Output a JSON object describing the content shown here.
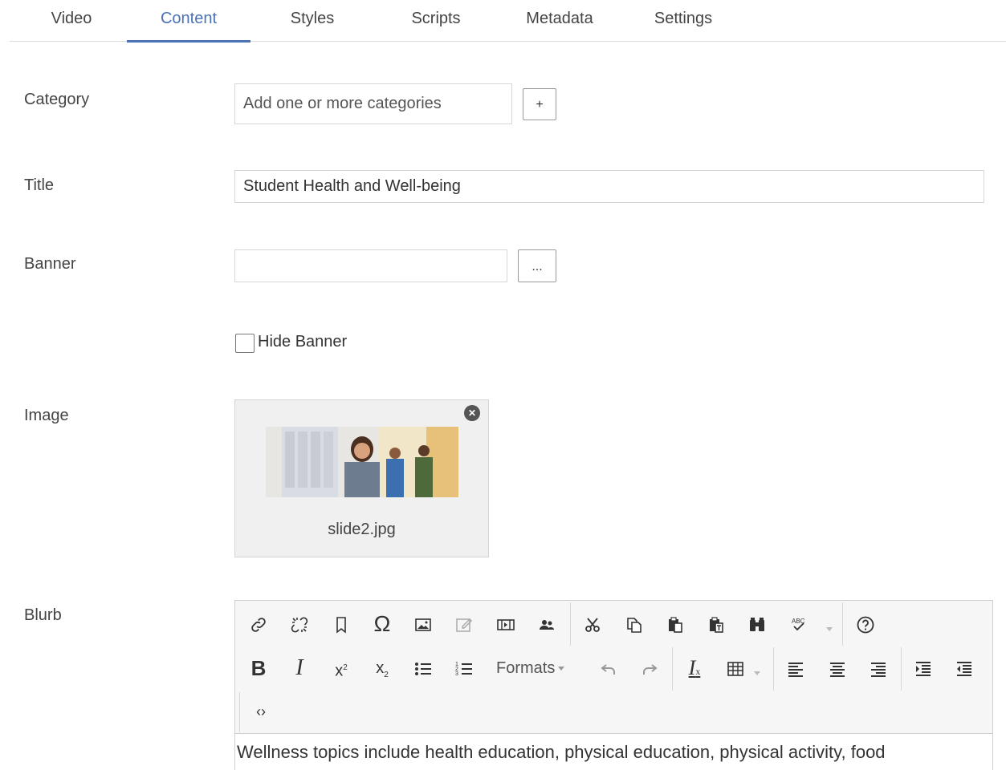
{
  "tabs": [
    {
      "label": "Video"
    },
    {
      "label": "Content",
      "active": true
    },
    {
      "label": "Styles"
    },
    {
      "label": "Scripts"
    },
    {
      "label": "Metadata"
    },
    {
      "label": "Settings"
    }
  ],
  "category": {
    "label": "Category",
    "placeholder": "Add one or more categories",
    "add_button": "+"
  },
  "title_field": {
    "label": "Title",
    "value": "Student Health and Well-being"
  },
  "banner": {
    "label": "Banner",
    "value": "",
    "browse_button": "...",
    "hide_label": "Hide Banner",
    "hide_checked": false
  },
  "image": {
    "label": "Image",
    "filename": "slide2.jpg",
    "remove_icon": "close-circle-icon"
  },
  "blurb": {
    "label": "Blurb",
    "toolbar_row1": [
      "link-icon",
      "unlink-icon",
      "bookmark-icon",
      "omega-icon",
      "image-icon",
      "edit-image-icon",
      "media-icon",
      "people-icon",
      "cut-icon",
      "copy-icon",
      "paste-icon",
      "paste-text-icon",
      "find-icon",
      "spellcheck-icon",
      "help-icon"
    ],
    "toolbar_row2": [
      "bold-icon",
      "italic-icon",
      "superscript-icon",
      "subscript-icon",
      "bullet-list-icon",
      "numbered-list-icon",
      "undo-icon",
      "redo-icon",
      "clear-format-icon",
      "table-icon",
      "align-left-icon",
      "align-center-icon",
      "align-right-icon",
      "indent-icon",
      "outdent-icon"
    ],
    "formats_label": "Formats",
    "content": "Wellness topics include health education, physical education, physical activity, food",
    "colors": {
      "accent": "#4a72b5"
    }
  }
}
